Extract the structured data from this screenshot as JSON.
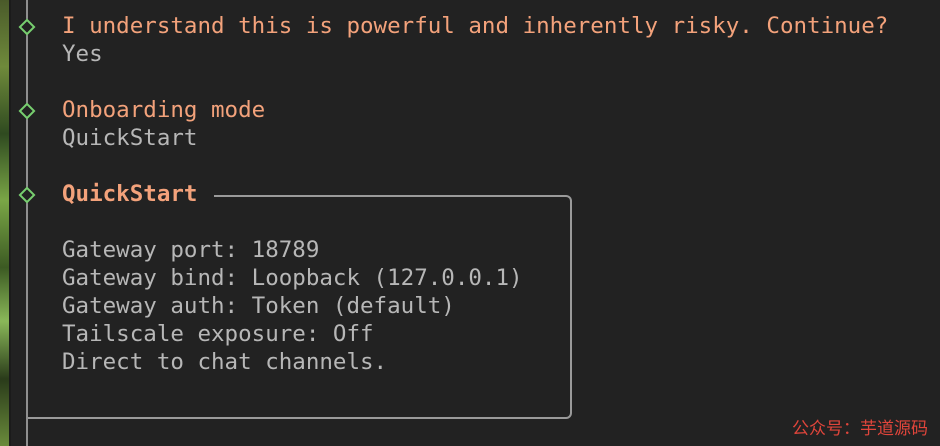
{
  "steps": [
    {
      "question": "I understand this is powerful and inherently risky. Continue?",
      "answer": "Yes"
    },
    {
      "question": "Onboarding mode",
      "answer": "QuickStart"
    }
  ],
  "quickstart": {
    "heading": "QuickStart",
    "lines": [
      "Gateway port: 18789",
      "Gateway bind: Loopback (127.0.0.1)",
      "Gateway auth: Token (default)",
      "Tailscale exposure: Off",
      "Direct to chat channels."
    ]
  },
  "watermark": "公众号：芋道源码",
  "colors": {
    "background": "#222222",
    "accent": "#f3a27b",
    "text": "#b7b7b7",
    "diamond": "#77cf6f",
    "watermark": "#e0453b"
  },
  "icons": {
    "step_marker": "diamond-icon"
  }
}
